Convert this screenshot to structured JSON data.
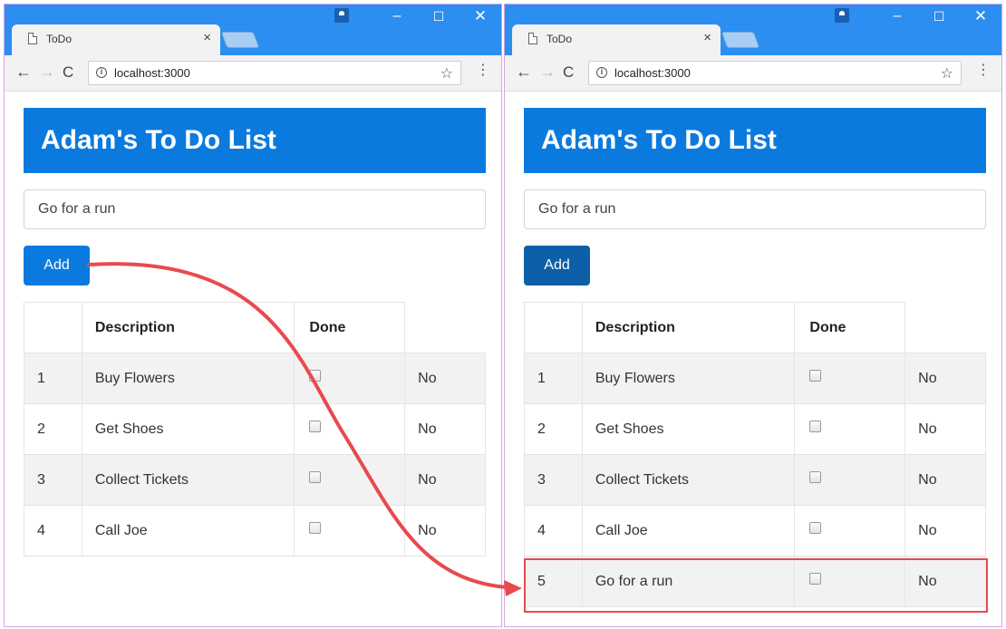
{
  "windows": [
    {
      "tab": {
        "title": "ToDo",
        "close": "×"
      },
      "window_controls": {
        "minimize": "–",
        "maximize": "☐",
        "close": "✕"
      },
      "toolbar": {
        "back": "←",
        "forward": "→",
        "reload": "C",
        "info": "i",
        "url": "localhost:3000",
        "star": "☆",
        "menu": "⋮"
      },
      "page": {
        "title": "Adam's To Do List",
        "input_value": "Go for a run",
        "add_label": "Add",
        "columns": [
          "",
          "Description",
          "Done"
        ],
        "rows": [
          {
            "id": "1",
            "description": "Buy Flowers",
            "done": "No"
          },
          {
            "id": "2",
            "description": "Get Shoes",
            "done": "No"
          },
          {
            "id": "3",
            "description": "Collect Tickets",
            "done": "No"
          },
          {
            "id": "4",
            "description": "Call Joe",
            "done": "No"
          }
        ]
      }
    },
    {
      "tab": {
        "title": "ToDo",
        "close": "×"
      },
      "window_controls": {
        "minimize": "–",
        "maximize": "☐",
        "close": "✕"
      },
      "toolbar": {
        "back": "←",
        "forward": "→",
        "reload": "C",
        "info": "i",
        "url": "localhost:3000",
        "star": "☆",
        "menu": "⋮"
      },
      "page": {
        "title": "Adam's To Do List",
        "input_value": "Go for a run",
        "add_label": "Add",
        "columns": [
          "",
          "Description",
          "Done"
        ],
        "rows": [
          {
            "id": "1",
            "description": "Buy Flowers",
            "done": "No"
          },
          {
            "id": "2",
            "description": "Get Shoes",
            "done": "No"
          },
          {
            "id": "3",
            "description": "Collect Tickets",
            "done": "No"
          },
          {
            "id": "4",
            "description": "Call Joe",
            "done": "No"
          },
          {
            "id": "5",
            "description": "Go for a run",
            "done": "No"
          }
        ]
      }
    }
  ],
  "colors": {
    "header_bg": "#0b7adf",
    "titlebar_bg": "#2b8ef0",
    "annotation": "#e84a4f"
  }
}
